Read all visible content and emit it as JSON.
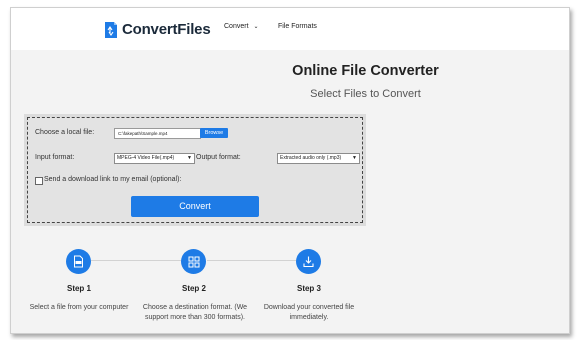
{
  "brand": {
    "name": "ConvertFiles",
    "accent": "#1e7be6"
  },
  "nav": {
    "items": [
      {
        "label": "Convert",
        "icon": "chevron-down-icon"
      },
      {
        "label": "File Formats"
      }
    ]
  },
  "main": {
    "title": "Online File Converter",
    "subtitle": "Select Files to Convert"
  },
  "form": {
    "file_label": "Choose a local file:",
    "file_value": "C:\\fakepath\\Sample.mp4",
    "browse_label": "Browse",
    "input_format_label": "Input format:",
    "input_format_value": "MPEG-4 Video File(.mp4)",
    "output_format_label": "Output format:",
    "output_format_value": "Extracted audio only (.mp3)",
    "email_checkbox_label": "Send a download link to my email (optional):",
    "convert_label": "Convert"
  },
  "steps": [
    {
      "title": "Step 1",
      "description": "Select a file from your computer",
      "icon": "file-icon"
    },
    {
      "title": "Step 2",
      "description": "Choose a destination format. (We support more than 300 formats).",
      "icon": "grid-icon"
    },
    {
      "title": "Step 3",
      "description": "Download your converted file immediately.",
      "icon": "download-icon"
    }
  ]
}
